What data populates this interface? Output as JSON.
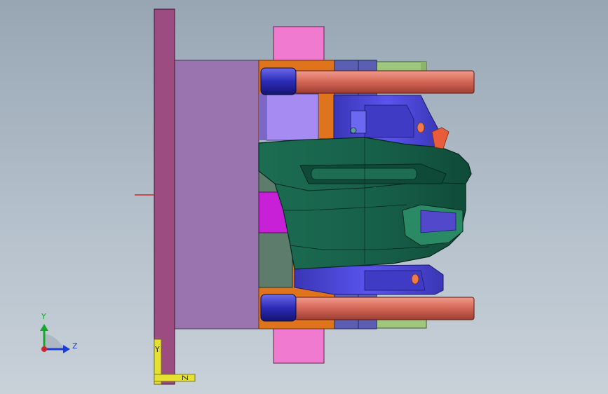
{
  "viewport": {
    "background_top": "#98a6b4",
    "background_bottom": "#c9d1d9"
  },
  "triad": {
    "icon": "coordinate-triad-icon",
    "y_label": "Y",
    "z_label": "Z",
    "y_color": "#16a82e",
    "z_color": "#1a3fd6",
    "origin_color": "#d2242a"
  },
  "ref_triad": {
    "icon": "reference-triad-icon",
    "y_label": "Y",
    "z_label": "Z",
    "color": "#e6e033"
  },
  "colors": {
    "clamp_plate": "#9d4c82",
    "mold_base": "#9a74ae",
    "support_block": "#f07ad0",
    "side_plate_orange": "#e0741c",
    "slider_blue": "#5a5fb4",
    "slider_lilac": "#a68cf2",
    "side_green": "#9cc77c",
    "part_green": "#165e48",
    "core_blue": "#4b45d9",
    "magenta_insert": "#c820d6",
    "grey_green": "#5e7c6c",
    "guide_pin": "#d76a5a",
    "pin_sleeve": "#2c2bb8"
  }
}
